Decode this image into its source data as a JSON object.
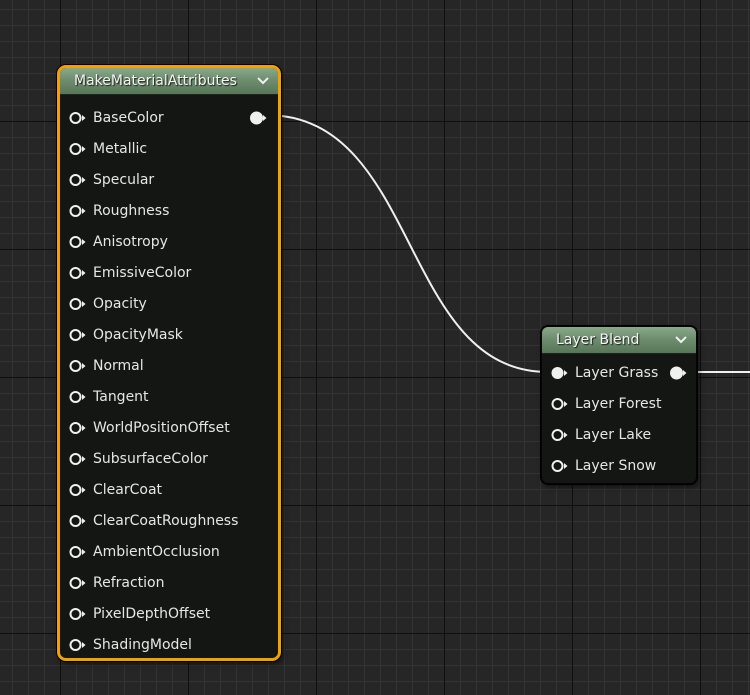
{
  "nodes": {
    "make_material_attributes": {
      "title": "MakeMaterialAttributes",
      "inputs": [
        {
          "label": "BaseColor",
          "connected": false
        },
        {
          "label": "Metallic",
          "connected": false
        },
        {
          "label": "Specular",
          "connected": false
        },
        {
          "label": "Roughness",
          "connected": false
        },
        {
          "label": "Anisotropy",
          "connected": false
        },
        {
          "label": "EmissiveColor",
          "connected": false
        },
        {
          "label": "Opacity",
          "connected": false
        },
        {
          "label": "OpacityMask",
          "connected": false
        },
        {
          "label": "Normal",
          "connected": false
        },
        {
          "label": "Tangent",
          "connected": false
        },
        {
          "label": "WorldPositionOffset",
          "connected": false
        },
        {
          "label": "SubsurfaceColor",
          "connected": false
        },
        {
          "label": "ClearCoat",
          "connected": false
        },
        {
          "label": "ClearCoatRoughness",
          "connected": false
        },
        {
          "label": "AmbientOcclusion",
          "connected": false
        },
        {
          "label": "Refraction",
          "connected": false
        },
        {
          "label": "PixelDepthOffset",
          "connected": false
        },
        {
          "label": "ShadingModel",
          "connected": false
        }
      ],
      "output_connected": true,
      "selected": true
    },
    "layer_blend": {
      "title": "Layer Blend",
      "inputs": [
        {
          "label": "Layer Grass",
          "connected": true
        },
        {
          "label": "Layer Forest",
          "connected": false
        },
        {
          "label": "Layer Lake",
          "connected": false
        },
        {
          "label": "Layer Snow",
          "connected": false
        }
      ],
      "output_connected": true,
      "selected": false
    }
  },
  "colors": {
    "selection_outline": "#f2a100",
    "header": "#6e8e6f",
    "node_body": "#141614",
    "wire": "#f0f0f0"
  },
  "icons": {
    "pin": "pin-icon",
    "collapse": "chevron-down-icon"
  }
}
